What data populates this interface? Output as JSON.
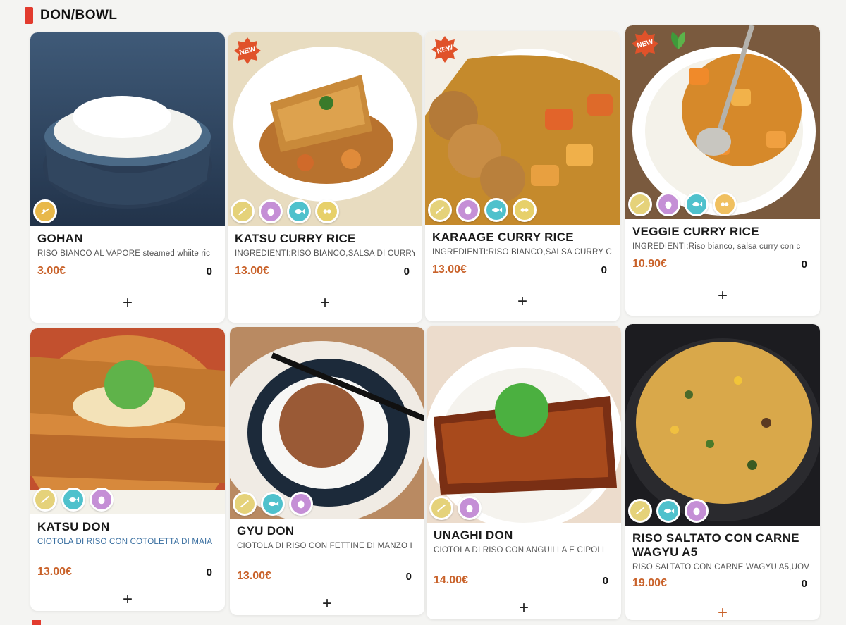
{
  "section": {
    "title": "DON/BOWL"
  },
  "colors": {
    "accent": "#e23b2e",
    "price": "#c9622a",
    "new_badge": "#e0522a"
  },
  "items": [
    {
      "name": "GOHAN",
      "description": "RISO BIANCO AL VAPORE steamed whiite ric",
      "price": "3.00€",
      "qty": "0",
      "add_label": "+",
      "badge_new": false,
      "badge_new_label": "",
      "vegetarian": false,
      "allergens": [
        "wheat-allergen-icon"
      ]
    },
    {
      "name": "KATSU CURRY RICE",
      "description": "INGREDIENTI:RISO BIANCO,SALSA DI CURRY",
      "price": "13.00€",
      "qty": "0",
      "add_label": "+",
      "badge_new": true,
      "badge_new_label": "NEW",
      "vegetarian": false,
      "allergens": [
        "cereal-allergen-icon",
        "egg-allergen-icon",
        "fish-allergen-icon",
        "soy-allergen-icon"
      ]
    },
    {
      "name": "KARAAGE CURRY RICE",
      "description": "INGREDIENTI:RISO BIANCO,SALSA CURRY C",
      "price": "13.00€",
      "qty": "0",
      "add_label": "+",
      "badge_new": true,
      "badge_new_label": "NEW",
      "vegetarian": false,
      "allergens": [
        "cereal-allergen-icon",
        "egg-allergen-icon",
        "fish-allergen-icon",
        "soy-allergen-icon"
      ]
    },
    {
      "name": "VEGGIE CURRY RICE",
      "description": "INGREDIENTI:Riso bianco,   salsa curry con c",
      "price": "10.90€",
      "qty": "0",
      "add_label": "+",
      "badge_new": true,
      "badge_new_label": "NEW",
      "vegetarian": true,
      "allergens": [
        "cereal-allergen-icon",
        "egg-allergen-icon",
        "fish-allergen-icon",
        "soy-allergen-icon"
      ]
    },
    {
      "name": "KATSU DON",
      "description": "CIOTOLA DI RISO CON COTOLETTA DI MAIA",
      "price": "13.00€",
      "qty": "0",
      "add_label": "+",
      "badge_new": false,
      "badge_new_label": "",
      "vegetarian": false,
      "allergens": [
        "cereal-allergen-icon",
        "fish-allergen-icon",
        "egg-allergen-icon"
      ]
    },
    {
      "name": "GYU DON",
      "description": "CIOTOLA DI RISO CON FETTINE DI MANZO I",
      "price": "13.00€",
      "qty": "0",
      "add_label": "+",
      "badge_new": false,
      "badge_new_label": "",
      "vegetarian": false,
      "allergens": [
        "cereal-allergen-icon",
        "fish-allergen-icon",
        "egg-allergen-icon"
      ]
    },
    {
      "name": "UNAGHI DON",
      "description": "CIOTOLA DI RISO CON ANGUILLA E CIPOLL",
      "price": "14.00€",
      "qty": "0",
      "add_label": "+",
      "badge_new": false,
      "badge_new_label": "",
      "vegetarian": false,
      "allergens": [
        "cereal-allergen-icon",
        "egg-allergen-icon"
      ]
    },
    {
      "name": "RISO SALTATO CON CARNE WAGYU A5",
      "description": "RISO SALTATO CON CARNE WAGYU A5,UOV",
      "price": "19.00€",
      "qty": "0",
      "add_label": "+",
      "badge_new": false,
      "badge_new_label": "",
      "vegetarian": false,
      "allergens": [
        "cereal-allergen-icon",
        "fish-allergen-icon",
        "egg-allergen-icon"
      ]
    }
  ]
}
